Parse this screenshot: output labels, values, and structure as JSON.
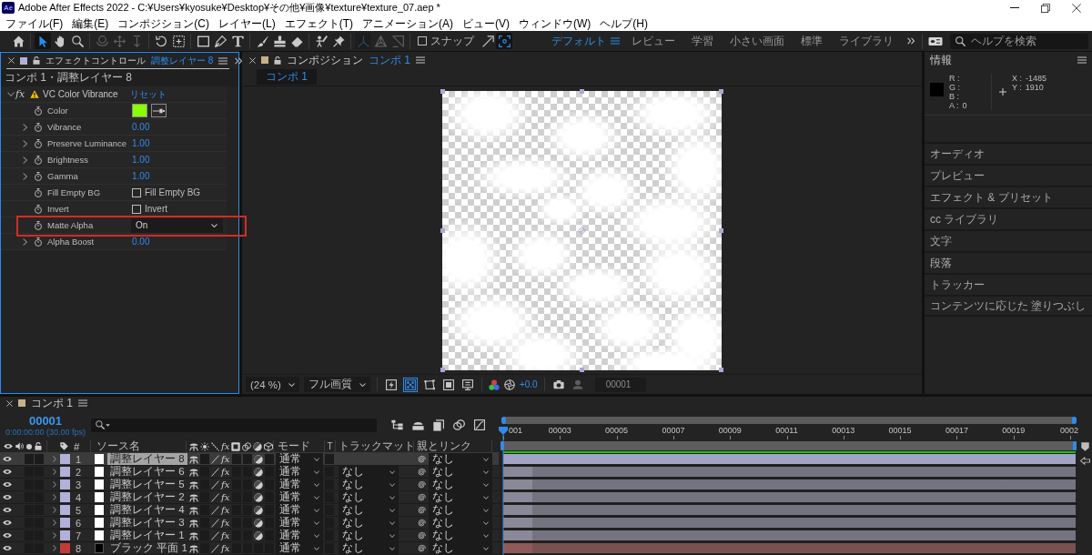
{
  "window": {
    "logo": "Ae",
    "title": "Adobe After Effects 2022 - C:¥Users¥kyosuke¥Desktop¥その他¥画像¥texture¥texture_07.aep *"
  },
  "menu": [
    "ファイル(F)",
    "編集(E)",
    "コンポジション(C)",
    "レイヤー(L)",
    "エフェクト(T)",
    "アニメーション(A)",
    "ビュー(V)",
    "ウィンドウ(W)",
    "ヘルプ(H)"
  ],
  "toolbar": {
    "tool_groups": [
      [
        {
          "kind": "home",
          "selected": false,
          "disabled": false
        }
      ],
      [
        {
          "kind": "selection",
          "selected": true,
          "disabled": false
        },
        {
          "kind": "hand",
          "selected": false,
          "disabled": false
        },
        {
          "kind": "zoom",
          "selected": false,
          "disabled": false
        }
      ],
      [
        {
          "kind": "orbit",
          "selected": false,
          "disabled": true
        },
        {
          "kind": "pan",
          "selected": false,
          "disabled": true
        },
        {
          "kind": "dolly",
          "selected": false,
          "disabled": true
        }
      ],
      [
        {
          "kind": "rotation",
          "selected": false,
          "disabled": false
        },
        {
          "kind": "pan-behind",
          "selected": false,
          "disabled": false
        }
      ],
      [
        {
          "kind": "rectangle",
          "selected": false,
          "disabled": false
        },
        {
          "kind": "pen",
          "selected": false,
          "disabled": false
        },
        {
          "kind": "type",
          "selected": false,
          "disabled": false
        }
      ],
      [
        {
          "kind": "brush",
          "selected": false,
          "disabled": false
        },
        {
          "kind": "stamp",
          "selected": false,
          "disabled": false
        },
        {
          "kind": "eraser",
          "selected": false,
          "disabled": false
        }
      ],
      [
        {
          "kind": "roto",
          "selected": false,
          "disabled": false
        },
        {
          "kind": "pin",
          "selected": false,
          "disabled": false
        }
      ],
      [
        {
          "kind": "axis-local",
          "selected": true,
          "disabled": true
        },
        {
          "kind": "axis-world",
          "selected": false,
          "disabled": true
        },
        {
          "kind": "axis-view",
          "selected": false,
          "disabled": true
        }
      ]
    ],
    "snap": {
      "label": "スナップ",
      "checked": false
    },
    "snap_tools": [
      {
        "kind": "snap-edges",
        "selected": false,
        "disabled": false
      },
      {
        "kind": "snap-features",
        "selected": true,
        "disabled": false
      }
    ],
    "workspaces": [
      {
        "label": "デフォルト",
        "selected": true
      },
      {
        "label": "レビュー",
        "selected": false
      },
      {
        "label": "学習",
        "selected": false
      },
      {
        "label": "小さい画面",
        "selected": false
      },
      {
        "label": "標準",
        "selected": false
      },
      {
        "label": "ライブラリ",
        "selected": false
      }
    ],
    "help_search": {
      "placeholder": "ヘルプを検索"
    }
  },
  "effect_controls": {
    "title": "エフェクトコントロール",
    "layer": "調整レイヤー 8",
    "breadcrumb": "コンポ 1・調整レイヤー 8",
    "effect": {
      "fx_switch": "fx",
      "on": true,
      "name": "VC Color Vibrance",
      "reset": "リセット",
      "expanded": true
    },
    "properties": [
      {
        "kind": "color",
        "name": "Color",
        "color": "#88ff00",
        "highlighted": false
      },
      {
        "kind": "number",
        "name": "Vibrance",
        "value": "0.00",
        "expanded": false,
        "highlighted": false
      },
      {
        "kind": "number",
        "name": "Preserve Luminance",
        "value": "1.00",
        "expanded": false,
        "highlighted": false
      },
      {
        "kind": "number",
        "name": "Brightness",
        "value": "1.00",
        "expanded": false,
        "highlighted": false
      },
      {
        "kind": "number",
        "name": "Gamma",
        "value": "1.00",
        "expanded": false,
        "highlighted": false
      },
      {
        "kind": "checkbox",
        "name": "Fill Empty BG",
        "label": "Fill Empty BG",
        "checked": false,
        "highlighted": false
      },
      {
        "kind": "checkbox",
        "name": "Invert",
        "label": "Invert",
        "checked": false,
        "highlighted": false
      },
      {
        "kind": "dropdown",
        "name": "Matte Alpha",
        "value": "On",
        "highlighted": true
      },
      {
        "kind": "number",
        "name": "Alpha Boost",
        "value": "0.00",
        "expanded": false,
        "highlighted": false
      }
    ]
  },
  "composition": {
    "title": "コンポジション",
    "comp": "コンポ 1",
    "viewer_tabs": [
      {
        "label": "コンポ 1",
        "selected": true
      }
    ],
    "zoom": "(24 %)",
    "resolution": "フル画質",
    "view_toggles": [
      {
        "kind": "fast-preview",
        "selected": false
      },
      {
        "kind": "transparency-grid",
        "selected": true
      },
      {
        "kind": "mask",
        "selected": false
      },
      {
        "kind": "region",
        "selected": false
      },
      {
        "kind": "guides",
        "selected": false
      }
    ],
    "exposure": "+0.0",
    "snapshots": [
      {
        "kind": "snapshot",
        "disabled": false
      },
      {
        "kind": "show-snapshot",
        "disabled": true
      }
    ],
    "frame": "00001"
  },
  "info": {
    "title": "情報",
    "color": "#000000",
    "channels": [
      {
        "label": "R :"
      },
      {
        "label": "G :"
      },
      {
        "label": "B :"
      },
      {
        "label": "A :",
        "value": "0"
      }
    ],
    "position": [
      {
        "label": "X :",
        "value": "-1485"
      },
      {
        "label": "Y :",
        "value": "1910"
      }
    ]
  },
  "panels": [
    "オーディオ",
    "プレビュー",
    "エフェクト & プリセット",
    "cc ライブラリ",
    "文字",
    "段落",
    "トラッカー",
    "コンテンツに応じた 塗りつぶし"
  ],
  "timeline": {
    "title": "コンポ 1",
    "current_time": "00001",
    "timecode": "0:00:00:00 (30.00 fps)",
    "columns": {
      "number": "#",
      "source_name": "ソース名",
      "fx": "fx",
      "mode": "モード",
      "t": "T",
      "track_matte": "トラックマット",
      "parent": "親とリンク"
    },
    "ruler": [
      "001",
      "00003",
      "00005",
      "00007",
      "00009",
      "00011",
      "00013",
      "00015",
      "00017",
      "00019",
      "0002"
    ],
    "layers": [
      {
        "number": "1",
        "name": "調整レイヤー 8",
        "kind": "adjustment",
        "color": "#b1b1da",
        "selected": true,
        "visible": true,
        "expanded": false,
        "fx": "fx",
        "mode": "通常",
        "parent": "なし"
      },
      {
        "number": "2",
        "name": "調整レイヤー 6",
        "kind": "adjustment",
        "color": "#b1b1da",
        "selected": false,
        "visible": true,
        "expanded": false,
        "fx": "fx",
        "mode": "通常",
        "track_matte": "なし",
        "parent": "なし"
      },
      {
        "number": "3",
        "name": "調整レイヤー 5",
        "kind": "adjustment",
        "color": "#b1b1da",
        "selected": false,
        "visible": true,
        "expanded": false,
        "fx": "fx",
        "mode": "通常",
        "track_matte": "なし",
        "parent": "なし"
      },
      {
        "number": "4",
        "name": "調整レイヤー 2",
        "kind": "adjustment",
        "color": "#b1b1da",
        "selected": false,
        "visible": true,
        "expanded": false,
        "fx": "fx",
        "mode": "通常",
        "track_matte": "なし",
        "parent": "なし"
      },
      {
        "number": "5",
        "name": "調整レイヤー 4",
        "kind": "adjustment",
        "color": "#b1b1da",
        "selected": false,
        "visible": true,
        "expanded": false,
        "fx": "fx",
        "mode": "通常",
        "track_matte": "なし",
        "parent": "なし"
      },
      {
        "number": "6",
        "name": "調整レイヤー 3",
        "kind": "adjustment",
        "color": "#b1b1da",
        "selected": false,
        "visible": true,
        "expanded": false,
        "fx": "fx",
        "mode": "通常",
        "track_matte": "なし",
        "parent": "なし"
      },
      {
        "number": "7",
        "name": "調整レイヤー 1",
        "kind": "adjustment",
        "color": "#b1b1da",
        "selected": false,
        "visible": true,
        "expanded": false,
        "fx": "fx",
        "mode": "通常",
        "track_matte": "なし",
        "parent": "なし"
      },
      {
        "number": "8",
        "name": "ブラック 平面 1",
        "kind": "solid",
        "color": "#c23b3b",
        "selected": false,
        "visible": true,
        "expanded": false,
        "fx": "fx",
        "mode": "通常",
        "track_matte": "なし",
        "parent": "なし"
      }
    ]
  }
}
